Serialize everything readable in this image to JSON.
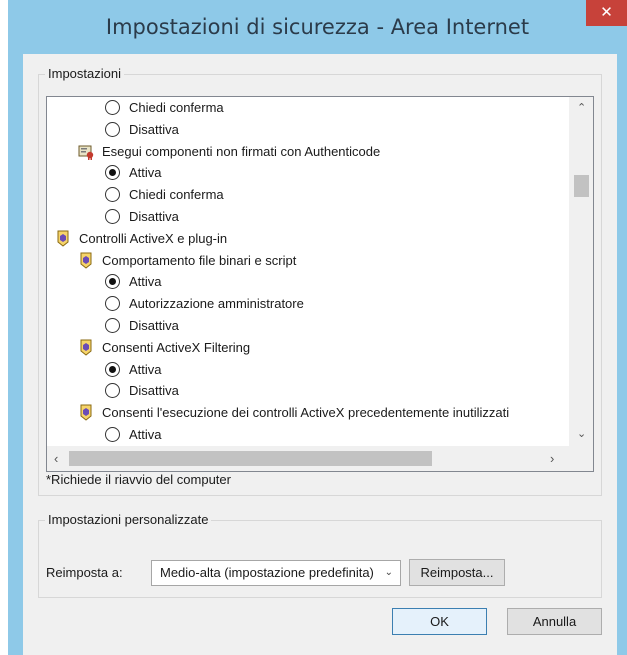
{
  "window": {
    "title": "Impostazioni di sicurezza - Area Internet",
    "close_glyph": "✕"
  },
  "settings_group": {
    "title": "Impostazioni",
    "list": [
      {
        "kind": "radio",
        "level": 2,
        "label": "Chiedi conferma",
        "checked": false
      },
      {
        "kind": "radio",
        "level": 2,
        "label": "Disattiva",
        "checked": false
      },
      {
        "kind": "setting",
        "level": 1,
        "label": "Esegui componenti non firmati con Authenticode",
        "icon": "certificate-icon"
      },
      {
        "kind": "radio",
        "level": 2,
        "label": "Attiva",
        "checked": true
      },
      {
        "kind": "radio",
        "level": 2,
        "label": "Chiedi conferma",
        "checked": false
      },
      {
        "kind": "radio",
        "level": 2,
        "label": "Disattiva",
        "checked": false
      },
      {
        "kind": "category",
        "level": 0,
        "label": "Controlli ActiveX e plug-in",
        "icon": "gear-shield-icon"
      },
      {
        "kind": "setting",
        "level": 1,
        "label": "Comportamento file binari e script",
        "icon": "gear-shield-icon"
      },
      {
        "kind": "radio",
        "level": 2,
        "label": "Attiva",
        "checked": true
      },
      {
        "kind": "radio",
        "level": 2,
        "label": "Autorizzazione amministratore",
        "checked": false
      },
      {
        "kind": "radio",
        "level": 2,
        "label": "Disattiva",
        "checked": false
      },
      {
        "kind": "setting",
        "level": 1,
        "label": "Consenti ActiveX Filtering",
        "icon": "gear-shield-icon"
      },
      {
        "kind": "radio",
        "level": 2,
        "label": "Attiva",
        "checked": true
      },
      {
        "kind": "radio",
        "level": 2,
        "label": "Disattiva",
        "checked": false
      },
      {
        "kind": "setting",
        "level": 1,
        "label": "Consenti l'esecuzione dei controlli ActiveX precedentemente inutilizzati",
        "icon": "gear-shield-icon"
      },
      {
        "kind": "radio",
        "level": 2,
        "label": "Attiva",
        "checked": false
      }
    ],
    "restart_note": "*Richiede il riavvio del computer"
  },
  "custom_group": {
    "title": "Impostazioni personalizzate",
    "reset_label": "Reimposta a:",
    "reset_value": "Medio-alta (impostazione predefinita)",
    "reset_button": "Reimposta..."
  },
  "footer": {
    "ok": "OK",
    "cancel": "Annulla"
  },
  "colors": {
    "frame": "#8ec9e8",
    "close": "#c7423a",
    "client": "#f0f0f0"
  }
}
